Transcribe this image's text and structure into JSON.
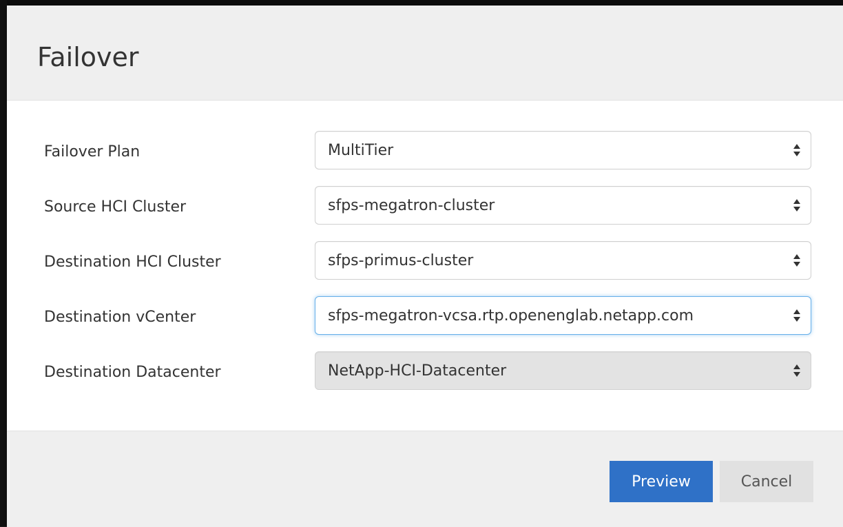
{
  "dialog": {
    "title": "Failover"
  },
  "form": {
    "fields": [
      {
        "label": "Failover Plan",
        "value": "MultiTier",
        "state": "normal"
      },
      {
        "label": "Source HCI Cluster",
        "value": "sfps-megatron-cluster",
        "state": "normal"
      },
      {
        "label": "Destination HCI Cluster",
        "value": "sfps-primus-cluster",
        "state": "normal"
      },
      {
        "label": "Destination vCenter",
        "value": "sfps-megatron-vcsa.rtp.openenglab.netapp.com",
        "state": "focused"
      },
      {
        "label": "Destination Datacenter",
        "value": "NetApp-HCI-Datacenter",
        "state": "disabled"
      }
    ]
  },
  "footer": {
    "preview_label": "Preview",
    "cancel_label": "Cancel"
  },
  "colors": {
    "primary": "#2f71c7",
    "focus_ring": "#66afe9",
    "disabled_bg": "#e3e3e3"
  },
  "icons": {
    "select_arrow": "sort-updown-icon"
  }
}
